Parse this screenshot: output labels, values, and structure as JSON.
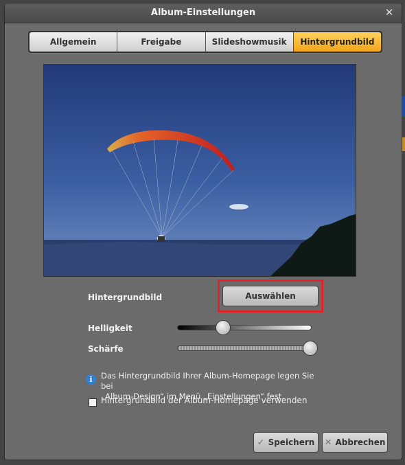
{
  "dialog": {
    "title": "Album-Einstellungen"
  },
  "tabs": [
    {
      "label": "Allgemein",
      "active": false
    },
    {
      "label": "Freigabe",
      "active": false
    },
    {
      "label": "Slideshowmusik",
      "active": false
    },
    {
      "label": "Hintergrundbild",
      "active": true
    }
  ],
  "background": {
    "label": "Hintergrundbild",
    "choose_button": "Auswählen"
  },
  "sliders": {
    "brightness": {
      "label": "Helligkeit",
      "value": 0.34
    },
    "sharpness": {
      "label": "Schärfe",
      "value": 0.99
    }
  },
  "info": {
    "text_line1": "Das Hintergrundbild Ihrer Album-Homepage legen Sie bei",
    "text_line2": "„Album-Design“ im Menü „Einstellungen“ fest."
  },
  "option": {
    "use_homepage_bg_label": "Hintergrundbild der Album-Homepage verwenden",
    "checked": false
  },
  "buttons": {
    "save": "Speichern",
    "cancel": "Abbrechen"
  },
  "colors": {
    "active_tab": "#f2a51c",
    "highlight": "#e2232a",
    "info": "#2f7fd3"
  }
}
